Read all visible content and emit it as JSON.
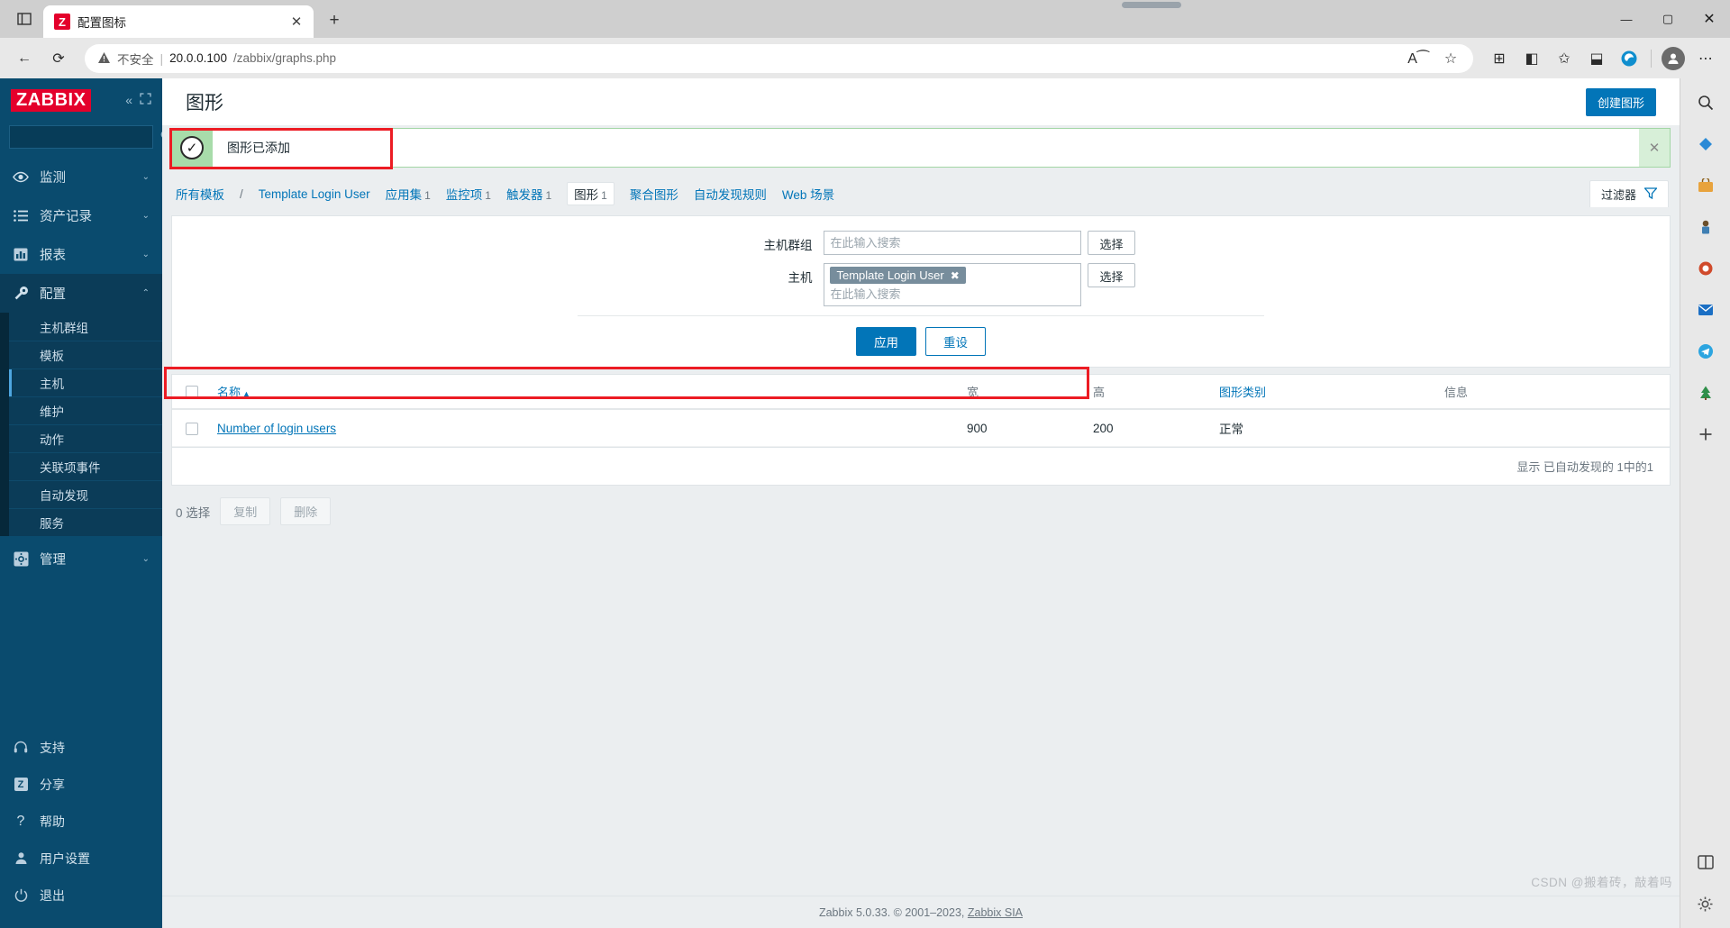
{
  "browser": {
    "tab": {
      "title": "配置图标",
      "favicon_letter": "Z",
      "close_icon": "✕"
    },
    "new_tab_icon": "+",
    "tab_list_icon": "▢",
    "window_controls": {
      "minimize": "—",
      "maximize": "▢",
      "close": "✕"
    },
    "nav": {
      "back_icon": "←",
      "refresh_icon": "⟳",
      "security_warning_icon": "⚠",
      "security_text": "不安全",
      "separator": "|",
      "url_host": "20.0.0.100",
      "url_path": "/zabbix/graphs.php",
      "read_aloud_icon": "A⁀",
      "favorite_icon": "☆",
      "collections_icon": "⊞",
      "split_screen_icon": "◧",
      "favorites_bar_icon": "✩",
      "browser_essentials_icon": "⬓",
      "edge_icon": "e",
      "profile_icon": "●",
      "settings_more_icon": "⋯",
      "bing_icon": "b"
    },
    "right_rail": [
      {
        "name": "search-icon",
        "glyph": "🔍"
      },
      {
        "name": "shopping-icon",
        "glyph": "🏷"
      },
      {
        "name": "tools-icon",
        "glyph": "🧰"
      },
      {
        "name": "games-icon",
        "glyph": "🎮"
      },
      {
        "name": "office-icon",
        "glyph": "🅞"
      },
      {
        "name": "outlook-icon",
        "glyph": "🅞"
      },
      {
        "name": "telegram-icon",
        "glyph": "✈"
      },
      {
        "name": "tree-icon",
        "glyph": "🌲"
      },
      {
        "name": "add-icon",
        "glyph": "+"
      },
      {
        "name": "split-icon",
        "glyph": "◧"
      },
      {
        "name": "settings-gear-icon",
        "glyph": "⚙"
      }
    ]
  },
  "sidebar": {
    "logo": "ZABBIX",
    "collapse_icon": "«",
    "expand_icon": "⛶",
    "search": {
      "placeholder": "",
      "value": "",
      "icon": "search-icon"
    },
    "nav": [
      {
        "label": "监测",
        "icon": "eye-icon",
        "caret": "⌄",
        "active": false
      },
      {
        "label": "资产记录",
        "icon": "list-icon",
        "caret": "⌄",
        "active": false
      },
      {
        "label": "报表",
        "icon": "chart-icon",
        "caret": "⌄",
        "active": false
      },
      {
        "label": "配置",
        "icon": "wrench-icon",
        "caret": "⌃",
        "active": true
      }
    ],
    "sub_items": [
      {
        "label": "主机群组",
        "active": false
      },
      {
        "label": "模板",
        "active": false
      },
      {
        "label": "主机",
        "active": true
      },
      {
        "label": "维护",
        "active": false
      },
      {
        "label": "动作",
        "active": false
      },
      {
        "label": "关联项事件",
        "active": false
      },
      {
        "label": "自动发现",
        "active": false
      },
      {
        "label": "服务",
        "active": false
      }
    ],
    "admin": {
      "label": "管理",
      "icon": "gear-icon",
      "caret": "⌄"
    },
    "bottom": [
      {
        "label": "支持",
        "icon": "headset-icon"
      },
      {
        "label": "分享",
        "icon": "zabbix-share-icon"
      },
      {
        "label": "帮助",
        "icon": "question-icon"
      },
      {
        "label": "用户设置",
        "icon": "user-icon"
      },
      {
        "label": "退出",
        "icon": "power-icon"
      }
    ]
  },
  "header": {
    "title": "图形",
    "create_button": "创建图形"
  },
  "message": {
    "text": "图形已添加",
    "check_icon": "✓",
    "close_icon": "✕"
  },
  "breadcrumb": {
    "all_templates": "所有模板",
    "separator": "/",
    "template_name": "Template Login User",
    "tabs": [
      {
        "label": "应用集",
        "count": "1",
        "active": false
      },
      {
        "label": "监控项",
        "count": "1",
        "active": false
      },
      {
        "label": "触发器",
        "count": "1",
        "active": false
      },
      {
        "label": "图形",
        "count": "1",
        "active": true
      },
      {
        "label": "聚合图形",
        "count": "",
        "active": false
      },
      {
        "label": "自动发现规则",
        "count": "",
        "active": false
      },
      {
        "label": "Web 场景",
        "count": "",
        "active": false
      }
    ],
    "filter_tab": {
      "label": "过滤器",
      "icon": "funnel-icon"
    }
  },
  "filter": {
    "host_group": {
      "label": "主机群组",
      "value": "",
      "placeholder": "在此输入搜索",
      "select_button": "选择"
    },
    "host": {
      "label": "主机",
      "chips": [
        {
          "label": "Template Login User",
          "remove_icon": "✖"
        }
      ],
      "placeholder": "在此输入搜索",
      "select_button": "选择"
    },
    "apply_button": "应用",
    "reset_button": "重设"
  },
  "table": {
    "headers": {
      "select_all": "",
      "name": "名称",
      "sort_arrow": "▲",
      "width": "宽",
      "height": "高",
      "graph_type": "图形类别",
      "info": "信息"
    },
    "rows": [
      {
        "name": "Number of login users",
        "width": "900",
        "height": "200",
        "graph_type": "正常",
        "info": ""
      }
    ],
    "row_count": "显示 已自动发现的 1中的1"
  },
  "footer_actions": {
    "selected_count": "0 选择",
    "copy_button": "复制",
    "delete_button": "删除"
  },
  "page_footer": {
    "text": "Zabbix 5.0.33. © 2001–2023,",
    "link": "Zabbix SIA"
  },
  "watermark": "CSDN @搬着砖，敲着吗",
  "colors": {
    "brand_red": "#e4002b",
    "sidebar_bg": "#0a4b6e",
    "accent_blue": "#0275b8",
    "success_bg": "#d7efd8",
    "annotation_red": "#ec1c24"
  }
}
